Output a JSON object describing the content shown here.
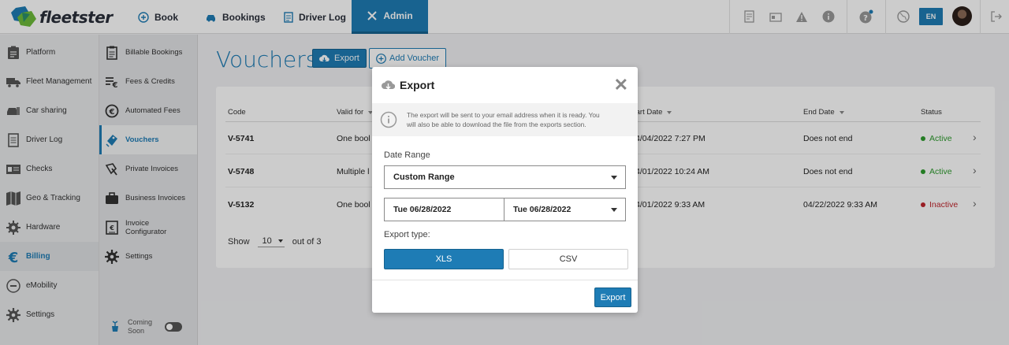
{
  "app": {
    "name": "fleetster"
  },
  "topnav": {
    "book": "Book",
    "bookings": "Bookings",
    "driver_log": "Driver Log",
    "admin": "Admin",
    "lang": "EN"
  },
  "sidebar": {
    "items": [
      {
        "label": "Platform",
        "icon": "clipboard-icon"
      },
      {
        "label": "Fleet Management",
        "icon": "truck-icon"
      },
      {
        "label": "Car sharing",
        "icon": "car-sharing-icon"
      },
      {
        "label": "Driver Log",
        "icon": "logbook-icon"
      },
      {
        "label": "Checks",
        "icon": "checks-icon"
      },
      {
        "label": "Geo & Tracking",
        "icon": "map-icon"
      },
      {
        "label": "Hardware",
        "icon": "gear-box-icon"
      },
      {
        "label": "Billing",
        "icon": "euro-icon"
      },
      {
        "label": "eMobility",
        "icon": "plug-icon"
      },
      {
        "label": "Settings",
        "icon": "gear-icon"
      }
    ]
  },
  "subnav": {
    "items": [
      {
        "label": "Billable Bookings",
        "icon": "clipboard-icon"
      },
      {
        "label": "Fees & Credits",
        "icon": "fees-icon"
      },
      {
        "label": "Automated Fees",
        "icon": "euro-cycle-icon"
      },
      {
        "label": "Vouchers",
        "icon": "voucher-icon"
      },
      {
        "label": "Private Invoices",
        "icon": "private-invoice-icon"
      },
      {
        "label": "Business Invoices",
        "icon": "briefcase-icon"
      },
      {
        "label": "Invoice\nConfigurator",
        "icon": "invoice-config-icon"
      },
      {
        "label": "Settings",
        "icon": "gear-icon"
      }
    ],
    "coming_soon": "Coming\nSoon"
  },
  "main": {
    "title": "Vouchers",
    "export_label": "Export",
    "add_label": "Add Voucher",
    "columns": {
      "code": "Code",
      "valid_for": "Valid for",
      "start_date": "tart Date",
      "end_date": "End Date",
      "status": "Status"
    },
    "rows": [
      {
        "code": "V-5741",
        "valid_for": "One bool",
        "start_date": "4/04/2022 7:27 PM",
        "end_date": "Does not end",
        "status": "Active"
      },
      {
        "code": "V-5748",
        "valid_for": "Multiple l",
        "start_date": "4/01/2022 10:24 AM",
        "end_date": "Does not end",
        "status": "Active"
      },
      {
        "code": "V-5132",
        "valid_for": "One bool",
        "start_date": "4/01/2022 9:33 AM",
        "end_date": "04/22/2022 9:33 AM",
        "status": "Inactive"
      }
    ],
    "pagination": {
      "show": "Show",
      "per_page": "10",
      "out_of": "out of 3"
    }
  },
  "modal": {
    "title": "Export",
    "info_line1": "The export will be sent to your email address when it is ready. You",
    "info_line2": "will also be able to download the file from the exports section.",
    "date_range_label": "Date Range",
    "date_range_value": "Custom Range",
    "date_from": "Tue 06/28/2022",
    "date_to": "Tue 06/28/2022",
    "export_type_label": "Export type:",
    "type_xls": "XLS",
    "type_csv": "CSV",
    "submit": "Export"
  },
  "colors": {
    "accent": "#1e7cb5",
    "active": "#2e9b2e",
    "inactive": "#c0262d"
  }
}
